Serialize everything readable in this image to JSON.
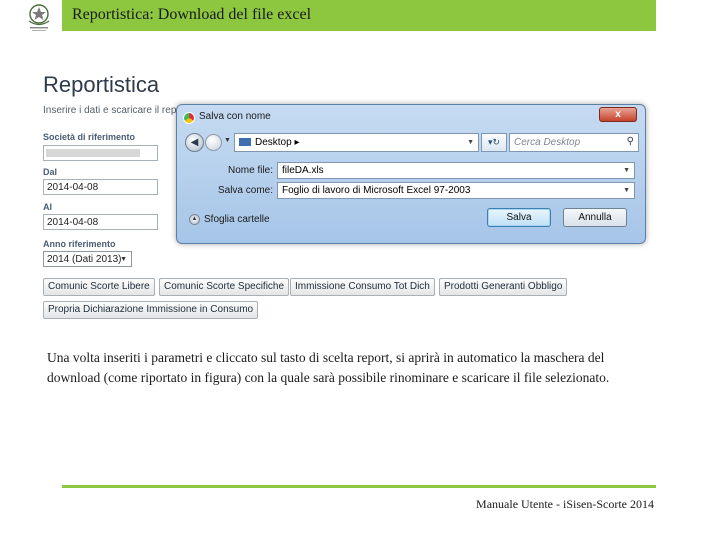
{
  "header": {
    "title": "Reportistica: Download del file excel"
  },
  "app": {
    "page_title": "Reportistica",
    "subtitle": "Inserire i dati e scaricare il repo",
    "fields": {
      "societa_label": "Società di riferimento",
      "dal_label": "Dal",
      "dal_value": "2014-04-08",
      "al_label": "Al",
      "al_value": "2014-04-08",
      "anno_label": "Anno riferimento",
      "anno_value": "2014 (Dati 2013)"
    },
    "buttons": [
      "Comunic Scorte Libere",
      "Comunic Scorte Specifiche",
      "Immissione Consumo Tot Dich",
      "Prodotti Generanti Obbligo",
      "Propria Dichiarazione Immissione in Consumo"
    ]
  },
  "dialog": {
    "title": "Salva con nome",
    "close_label": "x",
    "address": "Desktop",
    "search_placeholder": "Cerca Desktop",
    "filename_label": "Nome file:",
    "filename_value": "fileDA.xls",
    "savetype_label": "Salva come:",
    "savetype_value": "Foglio di lavoro di Microsoft Excel 97-2003",
    "browse_label": "Sfoglia cartelle",
    "save_label": "Salva",
    "cancel_label": "Annulla"
  },
  "body_text": "Una volta inseriti i parametri e cliccato sul tasto di scelta report, si aprirà in automatico la maschera del download (come riportato in figura) con la quale sarà possibile rinominare e scaricare il file selezionato.",
  "footer": {
    "text": "Manuale Utente - iSisen-Scorte 2014"
  },
  "colors": {
    "header_green": "#8dc63f",
    "dialog_frame": "#a6c5e8"
  },
  "icons": [
    "italian-republic-emblem-icon",
    "chrome-icon",
    "back-arrow-icon",
    "forward-arrow-icon",
    "folder-icon",
    "refresh-icon",
    "search-icon",
    "close-icon",
    "expand-icon"
  ]
}
